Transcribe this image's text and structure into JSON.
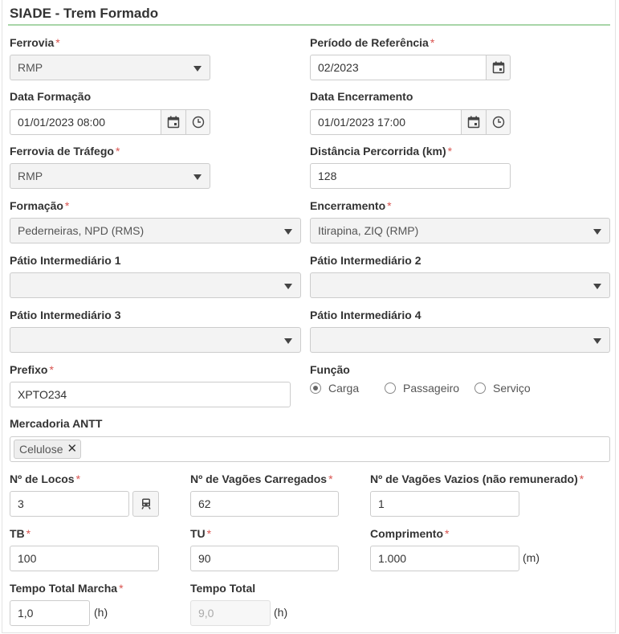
{
  "title": "SIADE - Trem Formado",
  "form": {
    "ferrovia": {
      "label": "Ferrovia",
      "value": "RMP"
    },
    "periodo": {
      "label": "Período de Referência",
      "value": "02/2023"
    },
    "data_formacao": {
      "label": "Data Formação",
      "value": "01/01/2023 08:00"
    },
    "data_encerramento": {
      "label": "Data Encerramento",
      "value": "01/01/2023 17:00"
    },
    "ferrovia_trafego": {
      "label": "Ferrovia de Tráfego",
      "value": "RMP"
    },
    "distancia": {
      "label": "Distância Percorrida (km)",
      "value": "128"
    },
    "formacao": {
      "label": "Formação",
      "value": "Pederneiras, NPD (RMS)"
    },
    "encerramento": {
      "label": "Encerramento",
      "value": "Itirapina, ZIQ (RMP)"
    },
    "patio1": {
      "label": "Pátio Intermediário 1",
      "value": ""
    },
    "patio2": {
      "label": "Pátio Intermediário 2",
      "value": ""
    },
    "patio3": {
      "label": "Pátio Intermediário 3",
      "value": ""
    },
    "patio4": {
      "label": "Pátio Intermediário 4",
      "value": ""
    },
    "prefixo": {
      "label": "Prefixo",
      "value": "XPTO234"
    },
    "funcao": {
      "label": "Função",
      "options": [
        "Carga",
        "Passageiro",
        "Serviço"
      ],
      "selected": "Carga"
    },
    "mercadoria": {
      "label": "Mercadoria ANTT",
      "tags": [
        "Celulose"
      ]
    },
    "locos": {
      "label": "Nº de Locos",
      "value": "3"
    },
    "vagoes_carregados": {
      "label": "Nº de Vagões Carregados",
      "value": "62"
    },
    "vagoes_vazios": {
      "label": "Nº de Vagões Vazios (não remunerado)",
      "value": "1"
    },
    "tb": {
      "label": "TB",
      "value": "100"
    },
    "tu": {
      "label": "TU",
      "value": "90"
    },
    "comprimento": {
      "label": "Comprimento",
      "value": "1.000",
      "unit": "(m)"
    },
    "tempo_marcha": {
      "label": "Tempo Total Marcha",
      "value": "1,0",
      "unit": "(h)"
    },
    "tempo_total": {
      "label": "Tempo Total",
      "value": "9,0",
      "unit": "(h)"
    }
  },
  "icons": {
    "calendar": "calendar-icon",
    "clock": "clock-icon",
    "train": "train-icon",
    "caret": "chevron-down-icon",
    "remove": "close-icon"
  },
  "colors": {
    "required": "#d9534f",
    "title_rule": "#a8d5a8"
  }
}
